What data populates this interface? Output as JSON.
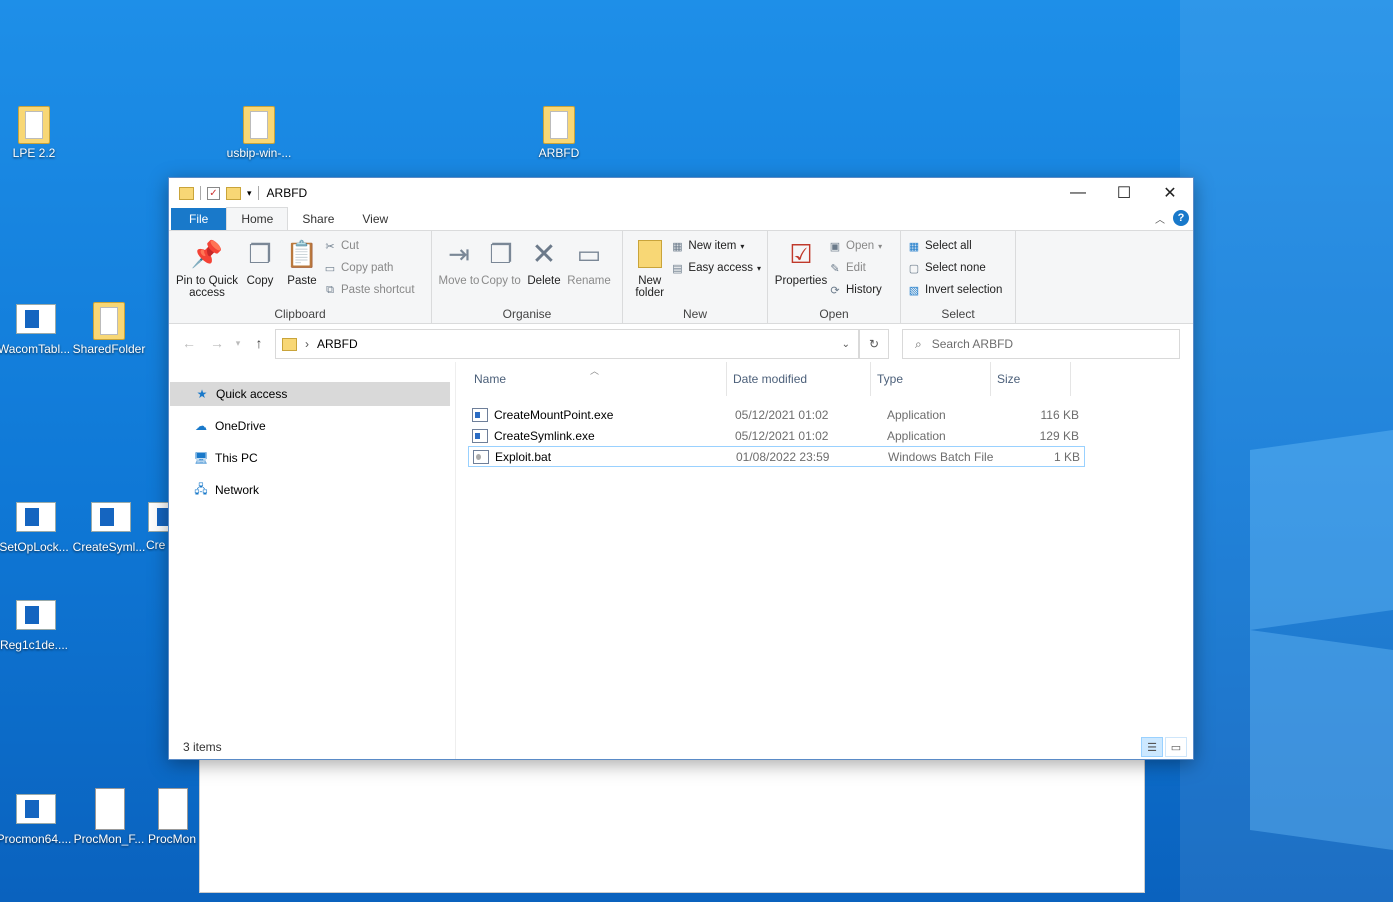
{
  "desktop": {
    "icons": [
      {
        "label": "LPE 2.2",
        "kind": "folder"
      },
      {
        "label": "usbip-win-...",
        "kind": "folder"
      },
      {
        "label": "ARBFD",
        "kind": "folder"
      },
      {
        "label": "WacomTabl...",
        "kind": "app"
      },
      {
        "label": "SharedFolder",
        "kind": "folder"
      },
      {
        "label": "SetOpLock...",
        "kind": "app"
      },
      {
        "label": "CreateSyml...",
        "kind": "app"
      },
      {
        "label": "Cre",
        "kind": "app"
      },
      {
        "label": "Reg1c1de....",
        "kind": "app"
      },
      {
        "label": "Procmon64....",
        "kind": "app"
      },
      {
        "label": "ProcMon_F...",
        "kind": "doc"
      },
      {
        "label": "ProcMon",
        "kind": "doc"
      }
    ]
  },
  "window": {
    "title": "ARBFD",
    "controls": {
      "minimize": "—",
      "maximize": "☐",
      "close": "✕"
    }
  },
  "tabs": {
    "file": "File",
    "home": "Home",
    "share": "Share",
    "view": "View"
  },
  "ribbon": {
    "clipboard": {
      "label": "Clipboard",
      "pin": "Pin to Quick access",
      "copy": "Copy",
      "paste": "Paste",
      "cut": "Cut",
      "copy_path": "Copy path",
      "paste_shortcut": "Paste shortcut"
    },
    "organise": {
      "label": "Organise",
      "move_to": "Move to",
      "copy_to": "Copy to",
      "delete": "Delete",
      "rename": "Rename"
    },
    "new": {
      "label": "New",
      "new_folder": "New folder",
      "new_item": "New item",
      "easy_access": "Easy access"
    },
    "open": {
      "label": "Open",
      "properties": "Properties",
      "open": "Open",
      "edit": "Edit",
      "history": "History"
    },
    "select": {
      "label": "Select",
      "select_all": "Select all",
      "select_none": "Select none",
      "invert": "Invert selection"
    }
  },
  "address": {
    "path": "ARBFD",
    "search_placeholder": "Search ARBFD"
  },
  "nav": [
    {
      "label": "Quick access",
      "icon": "star-icon"
    },
    {
      "label": "OneDrive",
      "icon": "cloud-icon"
    },
    {
      "label": "This PC",
      "icon": "computer-icon"
    },
    {
      "label": "Network",
      "icon": "network-icon"
    }
  ],
  "columns": {
    "name": "Name",
    "date": "Date modified",
    "type": "Type",
    "size": "Size"
  },
  "files": [
    {
      "name": "CreateMountPoint.exe",
      "date": "05/12/2021 01:02",
      "type": "Application",
      "size": "116 KB"
    },
    {
      "name": "CreateSymlink.exe",
      "date": "05/12/2021 01:02",
      "type": "Application",
      "size": "129 KB"
    },
    {
      "name": "Exploit.bat",
      "date": "01/08/2022 23:59",
      "type": "Windows Batch File",
      "size": "1 KB"
    }
  ],
  "status": {
    "items": "3 items"
  },
  "colors": {
    "accent": "#1979ca",
    "selection": "#cce8ff",
    "desktop": "#0f78d6"
  }
}
